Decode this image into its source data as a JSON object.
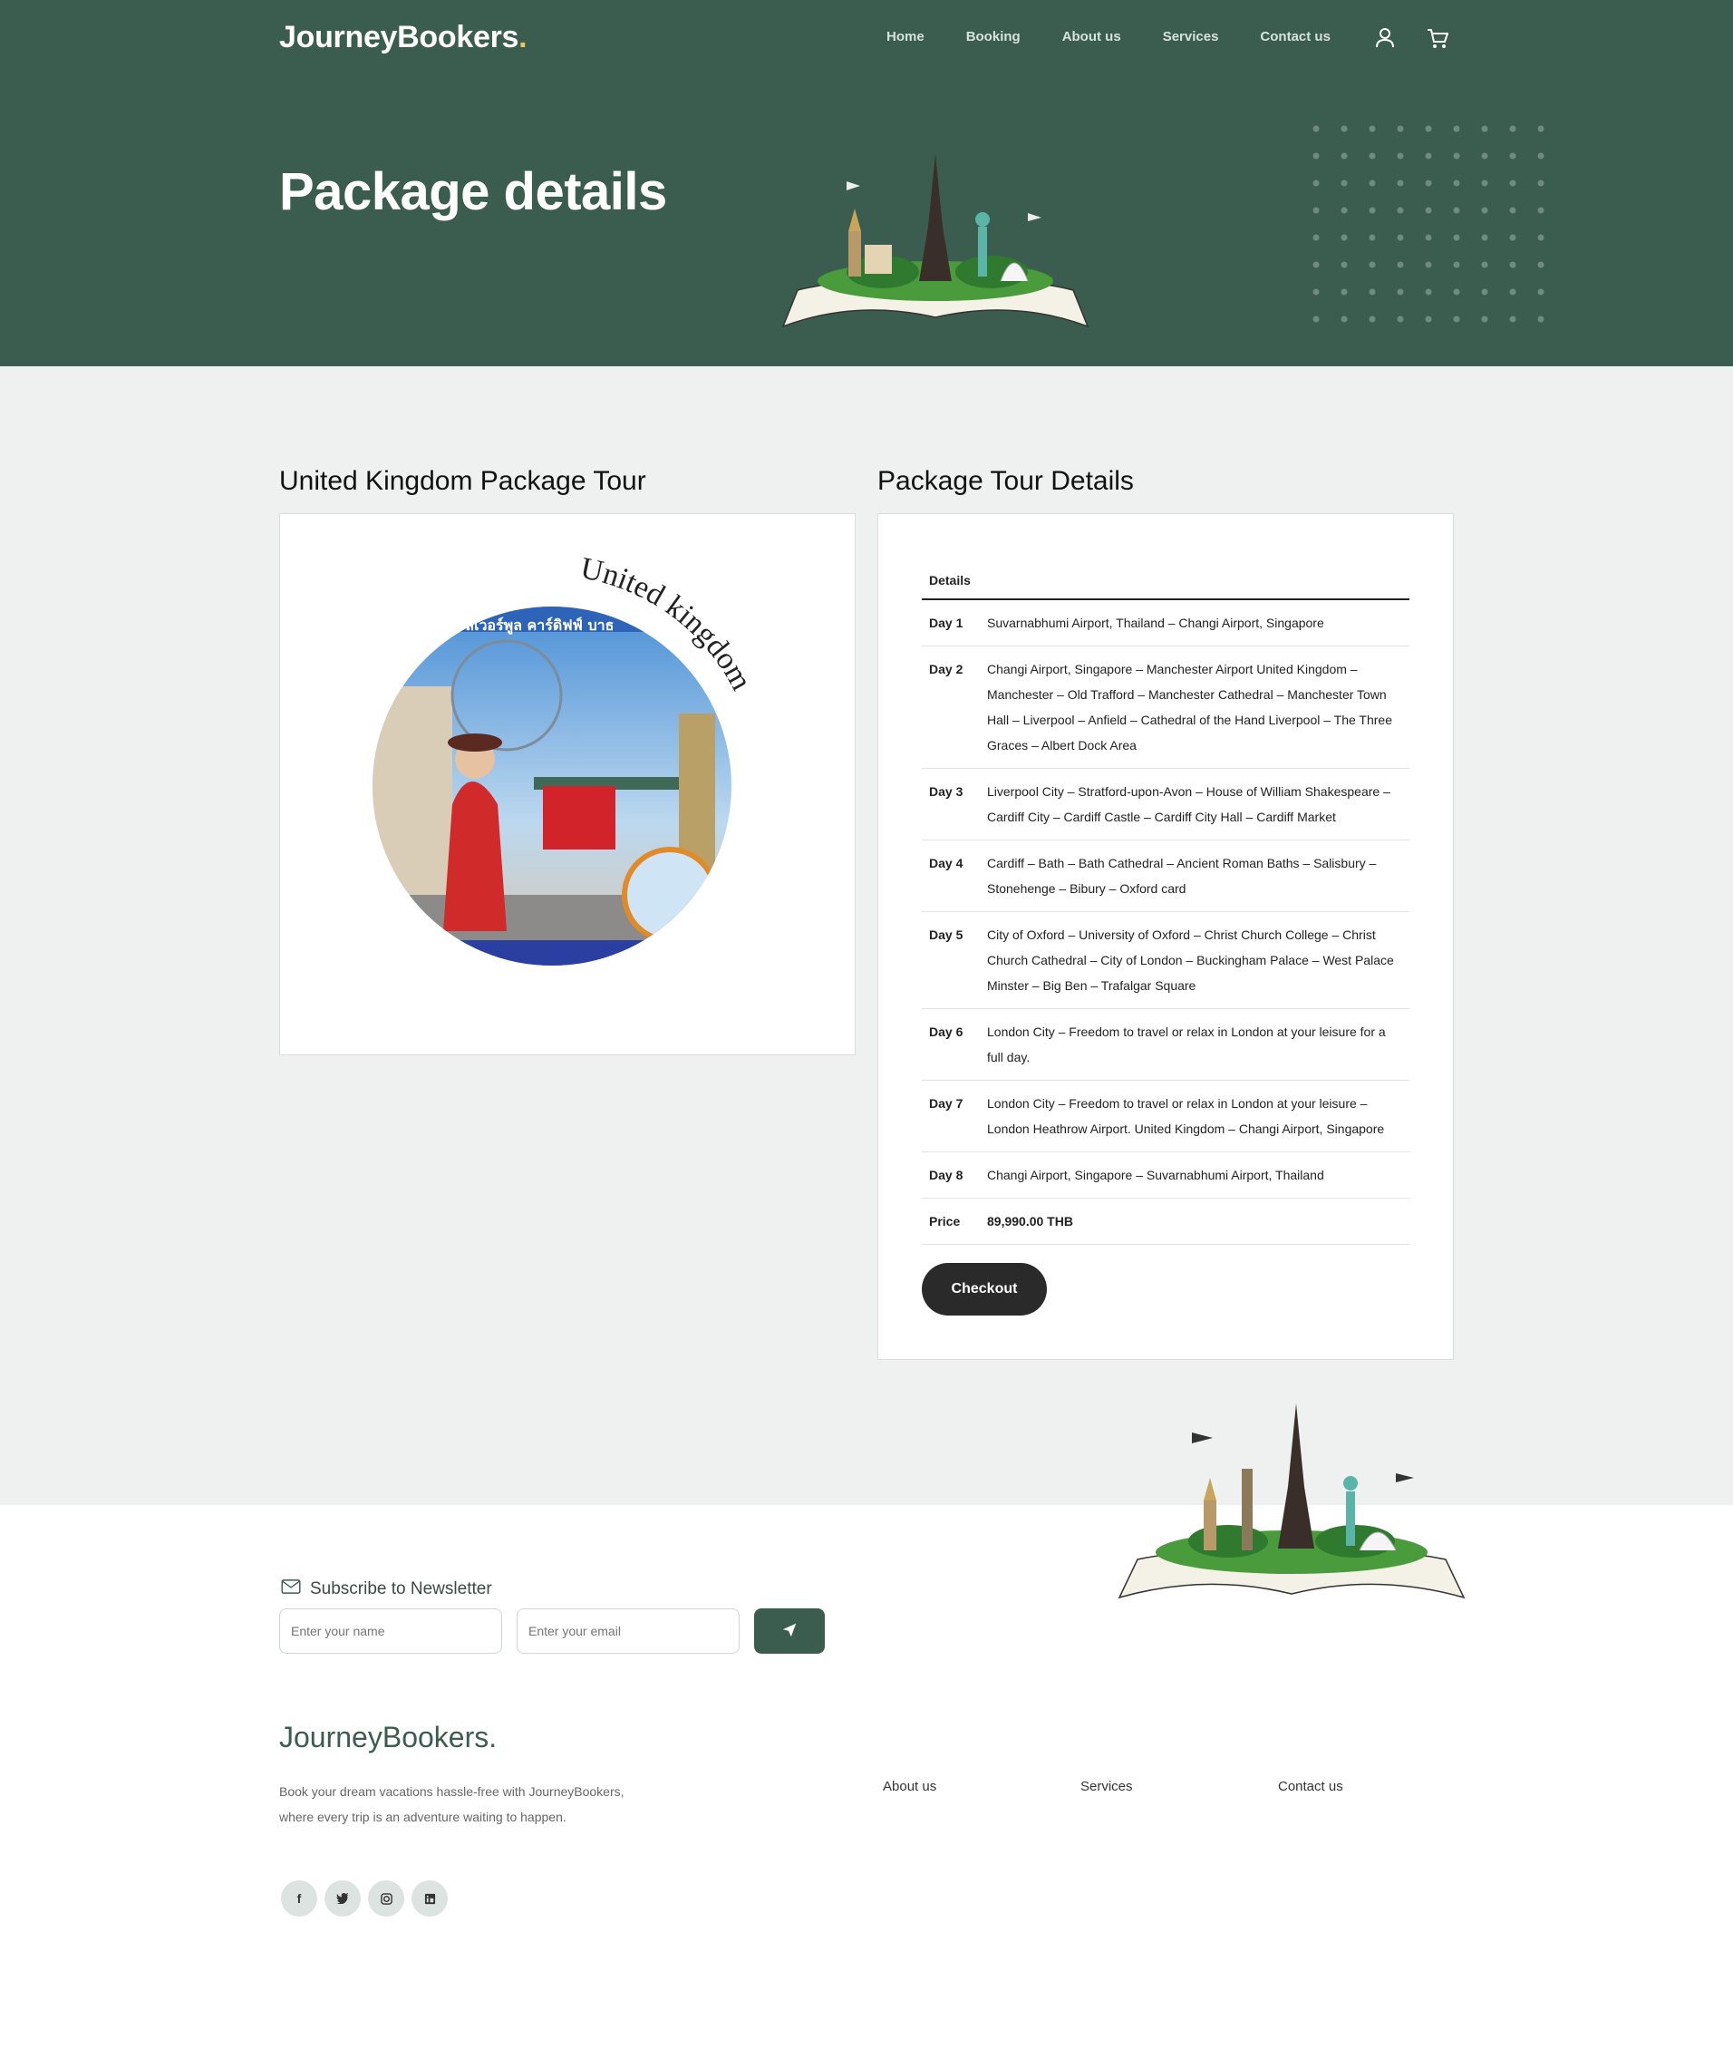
{
  "header": {
    "brand": "JourneyBookers",
    "brand_dot": ".",
    "nav": [
      "Home",
      "Booking",
      "About us",
      "Services",
      "Contact us"
    ],
    "icons": [
      "user-icon",
      "cart-icon"
    ],
    "page_title": "Package details"
  },
  "left": {
    "title": "United Kingdom Package Tour",
    "image_text": "United kingdom",
    "image_thai": "ร์ ลิเวอร์พูล คาร์ดิฟฟ์ บาธ"
  },
  "right": {
    "title": "Package Tour Details",
    "table_header": "Details",
    "rows": [
      {
        "day": "Day 1",
        "desc": "Suvarnabhumi Airport, Thailand – Changi Airport, Singapore"
      },
      {
        "day": "Day 2",
        "desc": "Changi Airport, Singapore – Manchester Airport United Kingdom – Manchester – Old Trafford – Manchester Cathedral – Manchester Town Hall – Liverpool – Anfield – Cathedral of the Hand Liverpool – The Three Graces – Albert Dock Area"
      },
      {
        "day": "Day 3",
        "desc": "Liverpool City – Stratford-upon-Avon – House of William Shakespeare – Cardiff City – Cardiff Castle – Cardiff City Hall – Cardiff Market"
      },
      {
        "day": "Day 4",
        "desc": "Cardiff – Bath – Bath Cathedral – Ancient Roman Baths – Salisbury – Stonehenge – Bibury – Oxford card"
      },
      {
        "day": "Day 5",
        "desc": "City of Oxford – University of Oxford – Christ Church College – Christ Church Cathedral – City of London – Buckingham Palace – West Palace Minster – Big Ben – Trafalgar Square"
      },
      {
        "day": "Day 6",
        "desc": "London City – Freedom to travel or relax in London at your leisure for a full day."
      },
      {
        "day": "Day 7",
        "desc": "London City – Freedom to travel or relax in London at your leisure – London Heathrow Airport. United Kingdom – Changi Airport, Singapore"
      },
      {
        "day": "Day 8",
        "desc": "Changi Airport, Singapore – Suvarnabhumi Airport, Thailand"
      }
    ],
    "price_label": "Price",
    "price_value": "89,990.00 THB",
    "checkout": "Checkout"
  },
  "footer": {
    "newsletter_label": "Subscribe to Newsletter",
    "name_placeholder": "Enter your name",
    "email_placeholder": "Enter your email",
    "brand": "JourneyBookers.",
    "description": "Book your dream vacations hassle-free with JourneyBookers, where every trip is an adventure waiting to happen.",
    "links": [
      "About us",
      "Services",
      "Contact us"
    ],
    "socials": [
      "facebook-icon",
      "twitter-icon",
      "instagram-icon",
      "linkedin-icon"
    ]
  },
  "colors": {
    "primary": "#3b5d4f",
    "background": "#eff1f0",
    "button_dark": "#2a2a2a"
  }
}
